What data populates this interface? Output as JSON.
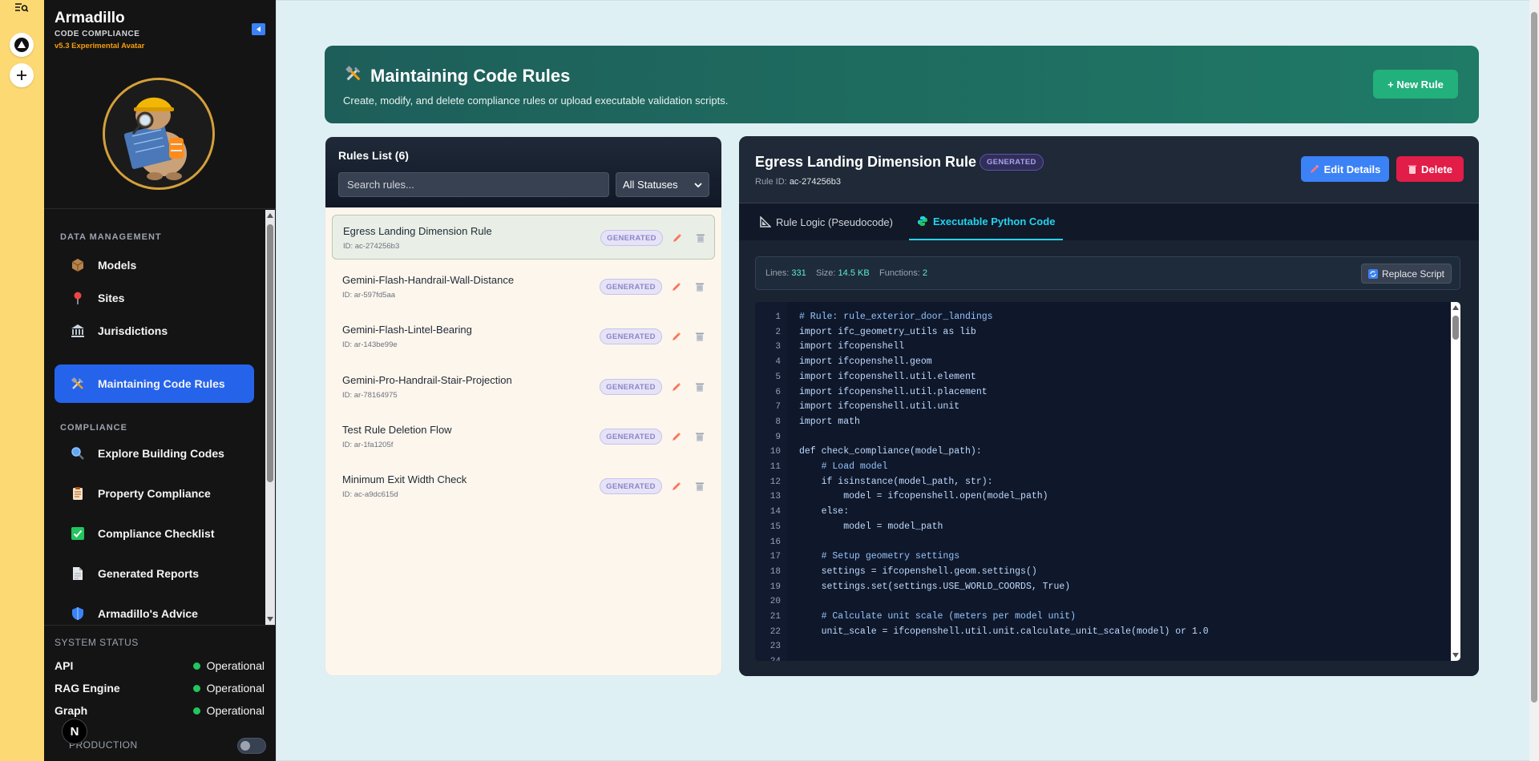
{
  "sidebar": {
    "brand_title": "Armadillo",
    "brand_subtitle": "CODE COMPLIANCE",
    "brand_version": "v5.3 Experimental Avatar",
    "sections": {
      "data_management": "DATA MANAGEMENT",
      "compliance": "COMPLIANCE"
    },
    "items": [
      {
        "label": "Models",
        "icon": "package-icon"
      },
      {
        "label": "Sites",
        "icon": "pin-icon"
      },
      {
        "label": "Jurisdictions",
        "icon": "bank-icon"
      },
      {
        "label": "Maintaining Code Rules",
        "icon": "tools-icon"
      },
      {
        "label": "Explore Building Codes",
        "icon": "magnifier-icon"
      },
      {
        "label": "Property Compliance",
        "icon": "clipboard-icon"
      },
      {
        "label": "Compliance Checklist",
        "icon": "check-box-icon"
      },
      {
        "label": "Generated Reports",
        "icon": "document-icon"
      },
      {
        "label": "Armadillo's Advice",
        "icon": "shield-icon"
      }
    ],
    "system_status": {
      "title": "SYSTEM STATUS",
      "rows": [
        {
          "label": "API",
          "value": "Operational"
        },
        {
          "label": "RAG Engine",
          "value": "Operational"
        },
        {
          "label": "Graph",
          "value": "Operational"
        }
      ],
      "production_label": "PRODUCTION"
    }
  },
  "header": {
    "title": "Maintaining Code Rules",
    "description": "Create, modify, and delete compliance rules or upload executable validation scripts.",
    "new_rule_label": "+ New Rule"
  },
  "rules": {
    "title": "Rules List (6)",
    "search_placeholder": "Search rules...",
    "status_filter": "All Statuses",
    "items": [
      {
        "name": "Egress Landing Dimension Rule",
        "id": "ID: ac-274256b3",
        "badge": "GENERATED"
      },
      {
        "name": "Gemini-Flash-Handrail-Wall-Distance",
        "id": "ID: ar-597fd5aa",
        "badge": "GENERATED"
      },
      {
        "name": "Gemini-Flash-Lintel-Bearing",
        "id": "ID: ar-143be99e",
        "badge": "GENERATED"
      },
      {
        "name": "Gemini-Pro-Handrail-Stair-Projection",
        "id": "ID: ar-78164975",
        "badge": "GENERATED"
      },
      {
        "name": "Test Rule Deletion Flow",
        "id": "ID: ar-1fa1205f",
        "badge": "GENERATED"
      },
      {
        "name": "Minimum Exit Width Check",
        "id": "ID: ac-a9dc615d",
        "badge": "GENERATED"
      }
    ]
  },
  "detail": {
    "title": "Egress Landing Dimension Rule",
    "badge": "GENERATED",
    "rule_id_label": "Rule ID:",
    "rule_id": "ac-274256b3",
    "edit_label": "Edit Details",
    "delete_label": "Delete",
    "tabs": [
      "Rule Logic (Pseudocode)",
      "Executable Python Code"
    ],
    "meta": {
      "lines_label": "Lines:",
      "lines": "331",
      "size_label": "Size:",
      "size": "14.5 KB",
      "functions_label": "Functions:",
      "functions": "2"
    },
    "replace_label": "Replace Script",
    "code_lines": [
      "# Rule: rule_exterior_door_landings",
      "import ifc_geometry_utils as lib",
      "import ifcopenshell",
      "import ifcopenshell.geom",
      "import ifcopenshell.util.element",
      "import ifcopenshell.util.placement",
      "import ifcopenshell.util.unit",
      "import math",
      "",
      "def check_compliance(model_path):",
      "    # Load model",
      "    if isinstance(model_path, str):",
      "        model = ifcopenshell.open(model_path)",
      "    else:",
      "        model = model_path",
      "",
      "    # Setup geometry settings",
      "    settings = ifcopenshell.geom.settings()",
      "    settings.set(settings.USE_WORLD_COORDS, True)",
      "",
      "    # Calculate unit scale (meters per model unit)",
      "    unit_scale = ifcopenshell.util.unit.calculate_unit_scale(model) or 1.0",
      "",
      ""
    ]
  }
}
